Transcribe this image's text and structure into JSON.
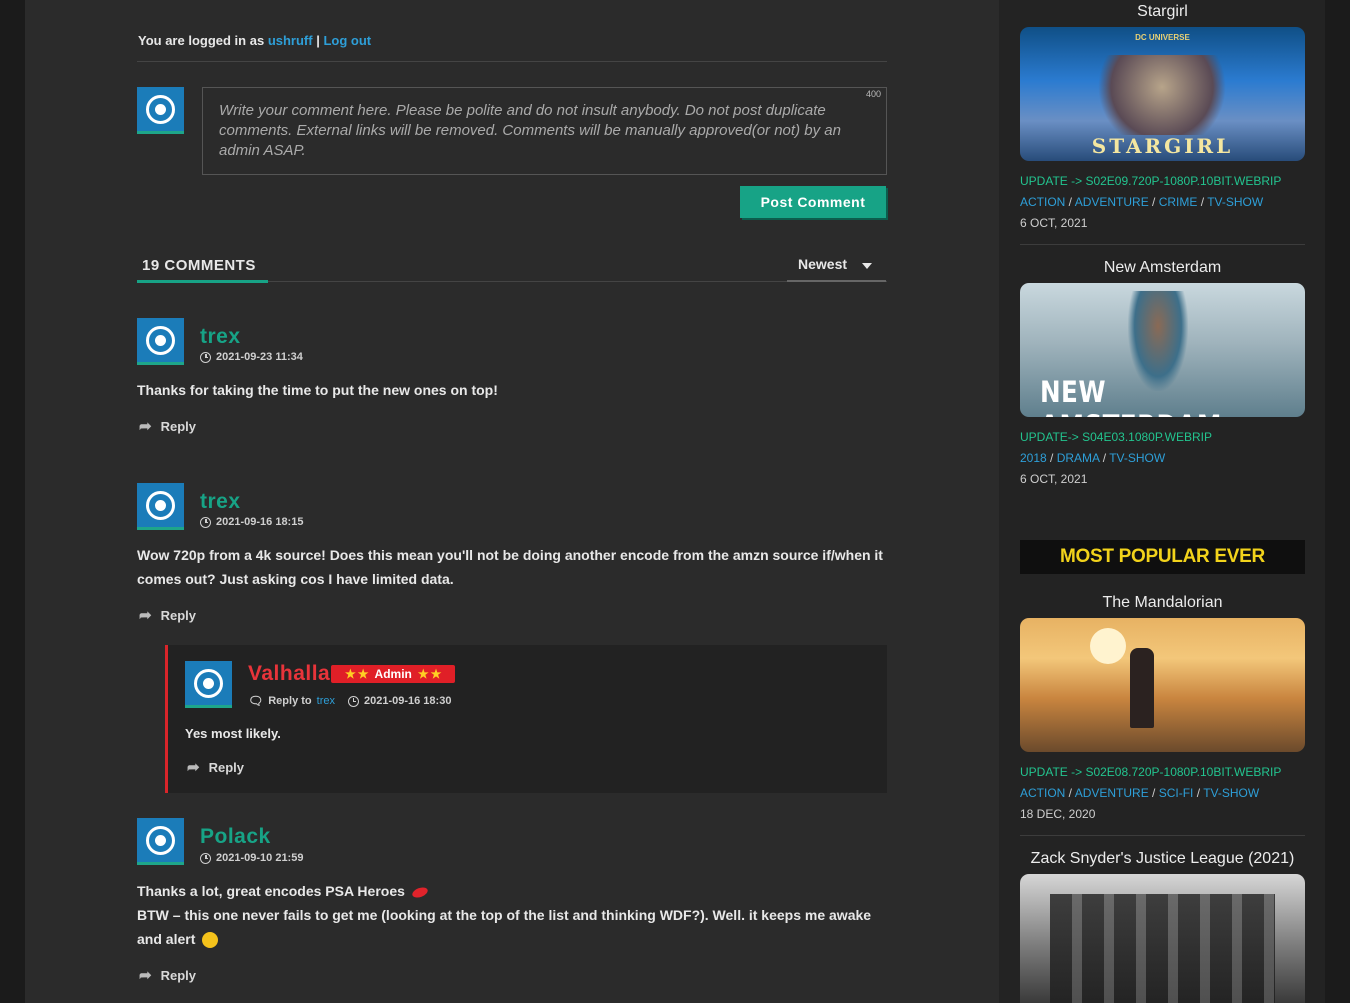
{
  "login": {
    "prefix": "You are logged in as",
    "username": "ushruff",
    "separator": "|",
    "logout": "Log out"
  },
  "form": {
    "placeholder": "Write your comment here. Please be polite and do not insult anybody. Do not post duplicate comments. External links will be removed. Comments will be manually approved(or not) by an admin ASAP.",
    "char_limit": "400",
    "submit_label": "Post Comment"
  },
  "thread": {
    "count_number": "19",
    "count_label": "COMMENTS",
    "sort_value": "Newest"
  },
  "comments": [
    {
      "author": "trex",
      "date": "2021-09-23 11:34",
      "text": "Thanks for taking the time to put the new ones on top!",
      "reply": "Reply"
    },
    {
      "author": "trex",
      "date": "2021-09-16 18:15",
      "text": "Wow 720p from a 4k source! Does this mean you'll not be doing another encode from the amzn source if/when it comes out? Just asking cos I have limited data.",
      "reply": "Reply"
    },
    {
      "author": "Valhalla",
      "badge": "Admin",
      "reply_to_label": "Reply to",
      "reply_to": "trex",
      "date": "2021-09-16 18:30",
      "text": "Yes most likely.",
      "reply": "Reply"
    },
    {
      "author": "Polack",
      "date": "2021-09-10 21:59",
      "text_line1": "Thanks a lot, great encodes PSA Heroes",
      "text_line2": "BTW – this one never fails to get me (looking at the top of the list and thinking WDF?). Well. it keeps me awake and alert",
      "reply": "Reply"
    }
  ],
  "sidebar": {
    "recent": [
      {
        "title": "Stargirl",
        "thumb_text": "STARGIRL",
        "thumb_top": "DC UNIVERSE",
        "update": "UPDATE -> S02E09.720P-1080P.10BIT.WEBRIP",
        "cats": [
          "ACTION",
          "ADVENTURE",
          "CRIME",
          "TV-SHOW"
        ],
        "date": "6 OCT, 2021"
      },
      {
        "title": "New Amsterdam",
        "thumb_text": "NEW AMSTERDAM",
        "update": "UPDATE-> S04E03.1080P.WEBRIP",
        "cats": [
          "2018",
          "DRAMA",
          "TV-SHOW"
        ],
        "date": "6 OCT, 2021"
      }
    ],
    "popular_heading": "MOST POPULAR EVER",
    "popular": [
      {
        "title": "The Mandalorian",
        "update": "UPDATE -> S02E08.720P-1080P.10BIT.WEBRIP",
        "cats": [
          "ACTION",
          "ADVENTURE",
          "SCI-FI",
          "TV-SHOW"
        ],
        "date": "18 DEC, 2020"
      },
      {
        "title": "Zack Snyder's Justice League (2021)"
      }
    ]
  },
  "colors": {
    "accent": "#17a386",
    "link": "#2e9fd8",
    "admin": "#e01f27",
    "popular_text": "#f2d31b"
  }
}
